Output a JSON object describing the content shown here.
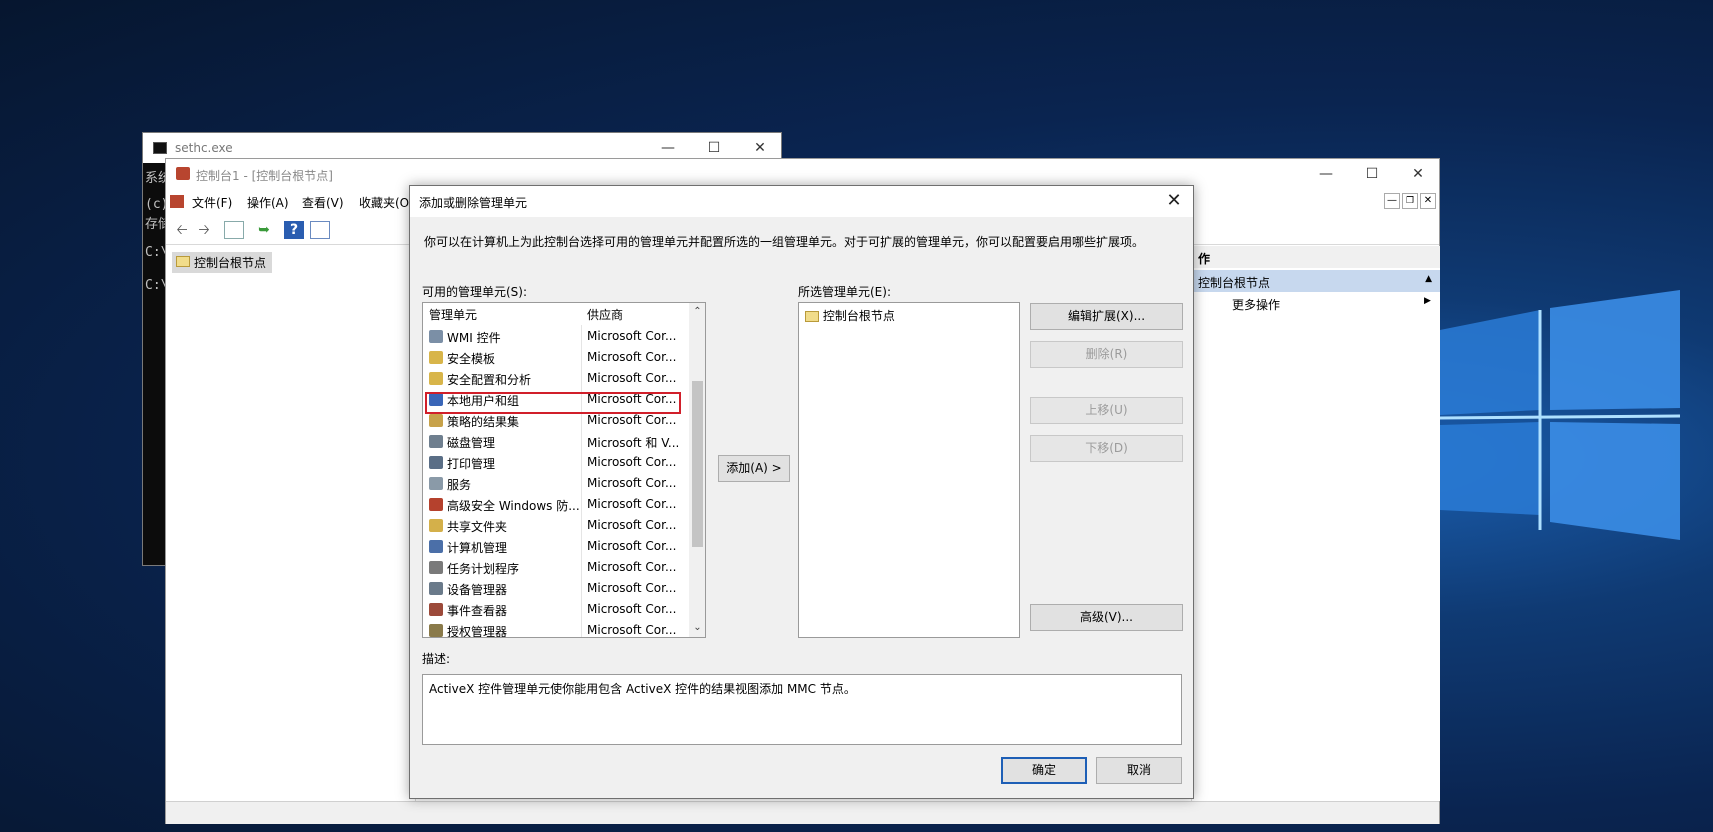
{
  "console": {
    "title": "sethc.exe",
    "lines": [
      "系统",
      "(c)",
      "存储",
      "C:\\",
      "C:\\"
    ],
    "icons": {
      "console": "cmd-icon"
    }
  },
  "mmc": {
    "title": "控制台1 - [控制台根节点]",
    "menu": [
      "文件(F)",
      "操作(A)",
      "查看(V)",
      "收藏夹(O"
    ],
    "tree_root": "控制台根节点",
    "actions_header": "作",
    "actions_selected": "控制台根节点",
    "actions_more": "更多操作"
  },
  "dialog": {
    "title": "添加或删除管理单元",
    "description_text": "你可以在计算机上为此控制台选择可用的管理单元并配置所选的一组管理单元。对于可扩展的管理单元，你可以配置要启用哪些扩展项。",
    "available_label": "可用的管理单元(S):",
    "selected_label": "所选管理单元(E):",
    "columns": [
      "管理单元",
      "供应商"
    ],
    "snapins": [
      {
        "name": "WMI 控件",
        "vendor": "Microsoft Cor...",
        "color": "#7b8fa6"
      },
      {
        "name": "安全模板",
        "vendor": "Microsoft Cor...",
        "color": "#d8b54a"
      },
      {
        "name": "安全配置和分析",
        "vendor": "Microsoft Cor...",
        "color": "#d8b54a"
      },
      {
        "name": "本地用户和组",
        "vendor": "Microsoft Cor...",
        "color": "#3a66b8"
      },
      {
        "name": "策略的结果集",
        "vendor": "Microsoft Cor...",
        "color": "#c7a24a"
      },
      {
        "name": "磁盘管理",
        "vendor": "Microsoft 和 V...",
        "color": "#6f7f8f"
      },
      {
        "name": "打印管理",
        "vendor": "Microsoft Cor...",
        "color": "#5a6e86"
      },
      {
        "name": "服务",
        "vendor": "Microsoft Cor...",
        "color": "#8a9aa8"
      },
      {
        "name": "高级安全 Windows 防...",
        "vendor": "Microsoft Cor...",
        "color": "#b5412d"
      },
      {
        "name": "共享文件夹",
        "vendor": "Microsoft Cor...",
        "color": "#d4b04a"
      },
      {
        "name": "计算机管理",
        "vendor": "Microsoft Cor...",
        "color": "#4b6fa8"
      },
      {
        "name": "任务计划程序",
        "vendor": "Microsoft Cor...",
        "color": "#7a7a7a"
      },
      {
        "name": "设备管理器",
        "vendor": "Microsoft Cor...",
        "color": "#6a7a8a"
      },
      {
        "name": "事件查看器",
        "vendor": "Microsoft Cor...",
        "color": "#9c4a3a"
      },
      {
        "name": "授权管理器",
        "vendor": "Microsoft Cor...",
        "color": "#8a7a4a"
      }
    ],
    "highlighted_snapin": "本地用户和组",
    "selected_items": [
      "控制台根节点"
    ],
    "buttons": {
      "add": "添加(A) >",
      "edit_ext": "编辑扩展(X)...",
      "remove": "删除(R)",
      "move_up": "上移(U)",
      "move_down": "下移(D)",
      "advanced": "高级(V)...",
      "ok": "确定",
      "cancel": "取消"
    },
    "desc_label": "描述:",
    "desc_body": "ActiveX 控件管理单元使你能用包含 ActiveX 控件的结果视图添加 MMC 节点。"
  }
}
